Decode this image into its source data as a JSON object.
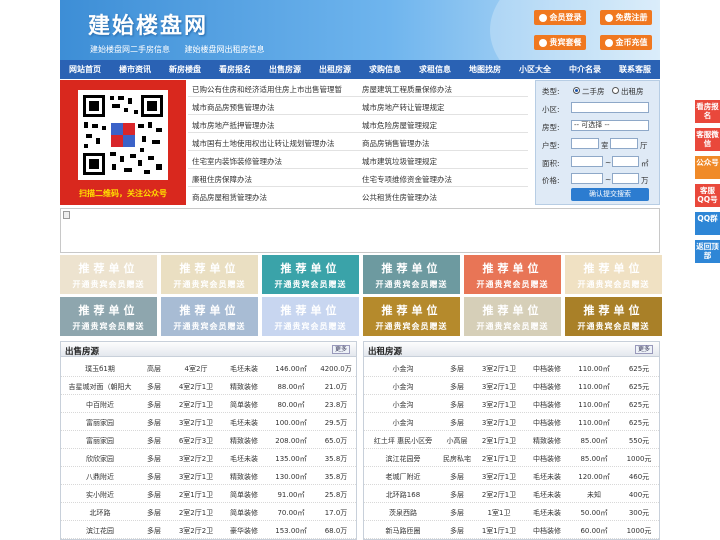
{
  "header": {
    "title": "建始楼盘网",
    "subtitle_links": [
      "建始楼盘网二手房信息",
      "建始楼盘网出租房信息"
    ],
    "buttons": [
      "会员登录",
      "免费注册",
      "贵宾套餐",
      "金币充值"
    ]
  },
  "nav": [
    "网站首页",
    "楼市资讯",
    "新房楼盘",
    "看房报名",
    "出售房源",
    "出租房源",
    "求购信息",
    "求租信息",
    "地图找房",
    "小区大全",
    "中介名录",
    "联系客服"
  ],
  "qr_caption": "扫描二维码，关注公众号",
  "links": [
    [
      "已购公有住房和经济适用住房上市出售管理暂",
      "房屋建筑工程质量保修办法"
    ],
    [
      "城市商品房预售管理办法",
      "城市房地产转让管理规定"
    ],
    [
      "城市房地产抵押管理办法",
      "城市危险房屋管理规定"
    ],
    [
      "城市国有土地使用权出让转让规划管理办法",
      "商品房销售管理办法"
    ],
    [
      "住宅室内装饰装修管理办法",
      "城市建筑垃圾管理规定"
    ],
    [
      "廉租住房保障办法",
      "住宅专项维修资金管理办法"
    ],
    [
      "商品房屋租赁管理办法",
      "公共租赁住房管理办法"
    ]
  ],
  "search": {
    "type_label": "类型:",
    "type_options": [
      "二手房",
      "出租房"
    ],
    "community_label": "小区:",
    "house_type_label": "房型:",
    "house_type_value": "-- 可选择 --",
    "layout_label": "户型:",
    "shi": "室",
    "ting": "厅",
    "area_label": "面积:",
    "area_unit": "㎡",
    "price_label": "价格:",
    "price_unit": "万",
    "submit": "确认提交搜索"
  },
  "tiles": {
    "title": "推荐单位",
    "subtitle": "开通贵宾会员赠送"
  },
  "colors": {
    "nav": "#2a62b4",
    "orange": "#f07820",
    "tile_colors": [
      "#ede3cf",
      "#eadfc2",
      "#3aa3a9",
      "#6d9aa0",
      "#e87556",
      "#f0e1c3",
      "#8ea6ae",
      "#a8bcd4",
      "#c8d6f0",
      "#b58a2c",
      "#d6cfb8",
      "#a98028"
    ]
  },
  "sale": {
    "title": "出售房源",
    "more": "更多",
    "rows": [
      [
        "璞玉б1期",
        "高层",
        "4室2厅",
        "毛坯未装",
        "146.00㎡",
        "4200.0万"
      ],
      [
        "吉星城对面（朝阳大",
        "多层",
        "4室2厅1卫",
        "精致装修",
        "88.00㎡",
        "21.0万"
      ],
      [
        "中百附近",
        "多层",
        "2室2厅1卫",
        "简单装修",
        "80.00㎡",
        "23.8万"
      ],
      [
        "富丽家园",
        "多层",
        "3室2厅1卫",
        "毛坯未装",
        "100.00㎡",
        "29.5万"
      ],
      [
        "富丽家园",
        "多层",
        "6室2厅3卫",
        "精致装修",
        "208.00㎡",
        "65.0万"
      ],
      [
        "欣欣家园",
        "多层",
        "3室2厅2卫",
        "毛坯未装",
        "135.00㎡",
        "35.8万"
      ],
      [
        "八鼎附近",
        "多层",
        "3室2厅1卫",
        "精致装修",
        "130.00㎡",
        "35.8万"
      ],
      [
        "实小附近",
        "多层",
        "2室1厅1卫",
        "简单装修",
        "91.00㎡",
        "25.8万"
      ],
      [
        "北环路",
        "多层",
        "2室2厅1卫",
        "简单装修",
        "70.00㎡",
        "17.0万"
      ],
      [
        "滨江花园",
        "多层",
        "3室2厅2卫",
        "豪华装修",
        "153.00㎡",
        "68.0万"
      ]
    ]
  },
  "rent": {
    "title": "出租房源",
    "more": "更多",
    "rows": [
      [
        "小金沟",
        "多层",
        "3室2厅1卫",
        "中档装修",
        "110.00㎡",
        "625元"
      ],
      [
        "小金沟",
        "多层",
        "3室2厅1卫",
        "中档装修",
        "110.00㎡",
        "625元"
      ],
      [
        "小金沟",
        "多层",
        "3室2厅1卫",
        "中档装修",
        "110.00㎡",
        "625元"
      ],
      [
        "小金沟",
        "多层",
        "3室2厅1卫",
        "中档装修",
        "110.00㎡",
        "625元"
      ],
      [
        "红土坪 惠民小区旁",
        "小高层",
        "2室1厅1卫",
        "精致装修",
        "85.00㎡",
        "550元"
      ],
      [
        "滨江花园旁",
        "民房私宅",
        "2室1厅1卫",
        "中档装修",
        "85.00㎡",
        "1000元"
      ],
      [
        "老城厂附近",
        "多层",
        "3室2厅1卫",
        "毛坯未装",
        "120.00㎡",
        "460元"
      ],
      [
        "北环路168",
        "多层",
        "2室2厅1卫",
        "毛坯未装",
        "未知",
        "400元"
      ],
      [
        "茨泉西路",
        "多层",
        "1室1卫",
        "毛坯未装",
        "50.00㎡",
        "300元"
      ],
      [
        "新马路匝圈",
        "多层",
        "1室1厅1卫",
        "中档装修",
        "60.00㎡",
        "1000元"
      ]
    ]
  },
  "floatbar": [
    "看房报名",
    "客服微信",
    "公众号",
    "客服QQ号",
    "QQ群",
    "返回顶部"
  ]
}
